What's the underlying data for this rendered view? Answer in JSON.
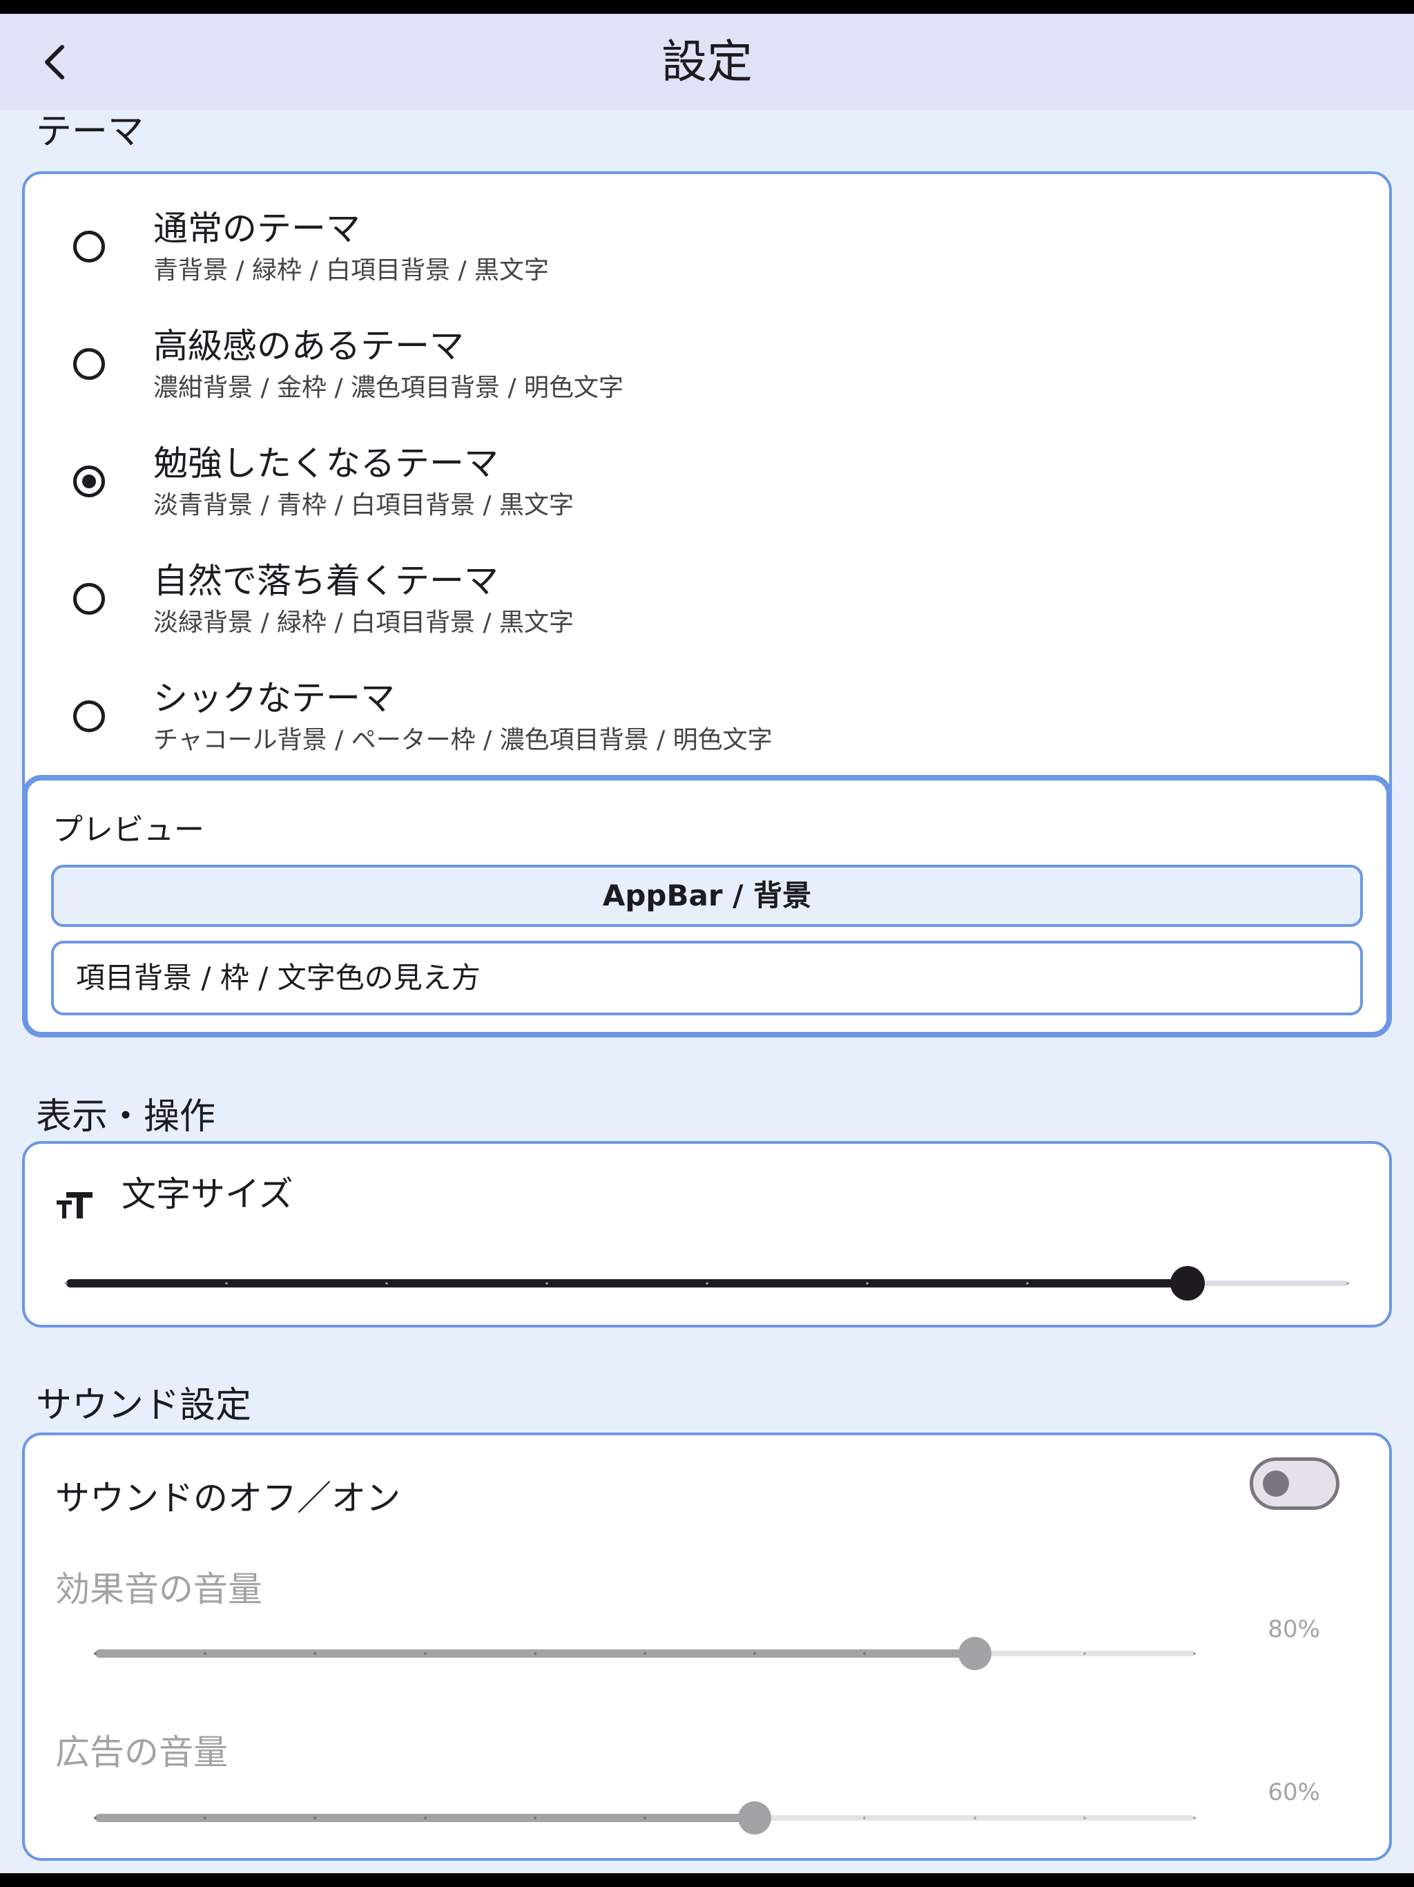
{
  "appbar": {
    "title": "設定"
  },
  "sections": {
    "theme": "テーマ",
    "display": "表示・操作",
    "sound": "サウンド設定"
  },
  "themes": [
    {
      "name": "通常のテーマ",
      "desc": "青背景 / 緑枠 / 白項目背景 / 黒文字",
      "selected": false
    },
    {
      "name": "高級感のあるテーマ",
      "desc": "濃紺背景 / 金枠 / 濃色項目背景 / 明色文字",
      "selected": false
    },
    {
      "name": "勉強したくなるテーマ",
      "desc": "淡青背景 / 青枠 / 白項目背景 / 黒文字",
      "selected": true
    },
    {
      "name": "自然で落ち着くテーマ",
      "desc": "淡緑背景 / 緑枠 / 白項目背景 / 黒文字",
      "selected": false
    },
    {
      "name": "シックなテーマ",
      "desc": "チャコール背景 / ペーター枠 / 濃色項目背景 / 明色文字",
      "selected": false
    }
  ],
  "preview": {
    "title": "プレビュー",
    "appbar_text": "AppBar / 背景",
    "item_text": "項目背景 / 枠 / 文字色の見え方"
  },
  "font_size": {
    "label": "文字サイズ",
    "icon": "text-size-icon",
    "level": 0.875,
    "divisions": 8
  },
  "sound": {
    "toggle_label": "サウンドのオフ／オン",
    "enabled": false,
    "sfx": {
      "label": "効果音の音量",
      "value": 0.8,
      "value_text": "80%",
      "divisions": 10
    },
    "ad": {
      "label": "広告の音量",
      "value": 0.6,
      "value_text": "60%",
      "divisions": 10
    }
  },
  "colors": {
    "accent": "#6b97e6",
    "background": "#e8effc",
    "appbar": "#dfe3f5",
    "disabled": "#a3a3a6"
  }
}
